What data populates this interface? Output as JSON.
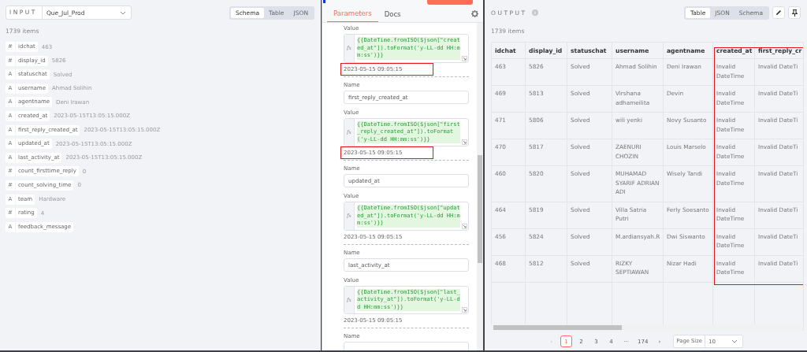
{
  "input_panel": {
    "title": "INPUT",
    "source": "Que_Jul_Prod",
    "views": [
      {
        "label": "Schema",
        "selected": true
      },
      {
        "label": "Table",
        "selected": false
      },
      {
        "label": "JSON",
        "selected": false
      }
    ],
    "count": "1739 items",
    "fields": [
      {
        "glyph": "#",
        "name": "idchat",
        "value": "463"
      },
      {
        "glyph": "#",
        "name": "display_id",
        "value": "5826"
      },
      {
        "glyph": "A",
        "name": "statuschat",
        "value": "Solved"
      },
      {
        "glyph": "A",
        "name": "username",
        "value": "Ahmad Solihin"
      },
      {
        "glyph": "A",
        "name": "agentname",
        "value": "Deni Irawan"
      },
      {
        "glyph": "A",
        "name": "created_at",
        "value": "2023-05-15T13:05:15.000Z"
      },
      {
        "glyph": "A",
        "name": "first_reply_created_at",
        "value": "2023-05-15T13:05:15.000Z"
      },
      {
        "glyph": "A",
        "name": "updated_at",
        "value": "2023-05-15T13:05:15.000Z"
      },
      {
        "glyph": "A",
        "name": "last_activity_at",
        "value": "2023-05-15T13:05:15.000Z"
      },
      {
        "glyph": "#",
        "name": "count_firsttime_reply",
        "value": "0"
      },
      {
        "glyph": "#",
        "name": "count_solving_time",
        "value": "0"
      },
      {
        "glyph": "A",
        "name": "team",
        "value": "Hardware"
      },
      {
        "glyph": "#",
        "name": "rating",
        "value": "4"
      },
      {
        "glyph": "A",
        "name": "feedback_message"
      }
    ]
  },
  "node_panel": {
    "tabs": [
      {
        "label": "Parameters",
        "selected": true
      },
      {
        "label": "Docs",
        "selected": false
      }
    ],
    "entries": [
      {
        "kind": "value",
        "label": "Value",
        "fx": "fx",
        "expression": "{{DateTime.fromISO($json[\"created_at\"]).toFormat('y-LL-dd HH:mm:ss')}}",
        "result": "2023-05-15 09:05:15",
        "highlighted": true
      },
      {
        "kind": "name",
        "label": "Name",
        "value": "first_reply_created_at"
      },
      {
        "kind": "value",
        "label": "Value",
        "fx": "fx",
        "expression": "{{DateTime.fromISO($json[\"first_reply_created_at\"]).toFormat('y-LL-dd HH:mm:ss')}}",
        "result": "2023-05-15 09:05:15",
        "highlighted": true
      },
      {
        "kind": "name",
        "label": "Name",
        "value": "updated_at"
      },
      {
        "kind": "value",
        "label": "Value",
        "fx": "fx",
        "expression": "{{DateTime.fromISO($json[\"updated_at\"]).toFormat('y-LL-dd HH:mm:ss')}}",
        "result": "2023-05-15 09:05:15"
      },
      {
        "kind": "name",
        "label": "Name",
        "value": "last_activity_at"
      },
      {
        "kind": "value",
        "label": "Value",
        "fx": "fx",
        "expression": "{{DateTime.fromISO($json[\"last_activity_at\"]).toFormat('y-LL-dd HH:mm:ss')}}",
        "result": "2023-05-15 09:05:15"
      },
      {
        "kind": "name",
        "label": "Name"
      }
    ]
  },
  "output_panel": {
    "title": "OUTPUT",
    "views": [
      {
        "label": "Table",
        "selected": true
      },
      {
        "label": "JSON",
        "selected": false
      },
      {
        "label": "Schema",
        "selected": false
      }
    ],
    "count": "1739 items",
    "table": {
      "columns": [
        "idchat",
        "display_id",
        "statuschat",
        "username",
        "agentname",
        "created_at",
        "first_reply_cr"
      ],
      "rows": [
        [
          "463",
          "5826",
          "Solved",
          "Ahmad Solihin",
          "Deni Irawan",
          "Invalid DateTime",
          "Invalid DateTi"
        ],
        [
          "469",
          "5813",
          "Solved",
          "Virshana adhameilita",
          "Devin",
          "Invalid DateTime",
          "Invalid DateTi"
        ],
        [
          "471",
          "5806",
          "Solved",
          "wili yenki",
          "Novy Susanto",
          "Invalid DateTime",
          "Invalid DateTi"
        ],
        [
          "470",
          "5817",
          "Solved",
          "ZAENURI CHOZIN",
          "Louis Marselo",
          "Invalid DateTime",
          "Invalid DateTi"
        ],
        [
          "460",
          "5820",
          "Solved",
          "MUHAMAD SYARIF ADRIAN ADI",
          "Wisely Tandi",
          "Invalid DateTime",
          "Invalid DateTi"
        ],
        [
          "464",
          "5819",
          "Solved",
          "Villa Satria Putri",
          "Ferly Soesanto",
          "Invalid DateTime",
          "Invalid DateTi"
        ],
        [
          "456",
          "5824",
          "Solved",
          "M.ardiansyah.R",
          "Dwi Siswanto",
          "Invalid DateTime",
          "Invalid DateTi"
        ],
        [
          "468",
          "5812",
          "Solved",
          "RIZKY SEPTIAWAN",
          "Nizar Hadi",
          "Invalid DateTime",
          "Invalid DateTi"
        ]
      ]
    },
    "pagination": {
      "prev": "‹",
      "pages": [
        {
          "label": "1",
          "selected": true
        },
        {
          "label": "2",
          "selected": false
        },
        {
          "label": "3",
          "selected": false
        },
        {
          "label": "4",
          "selected": false
        }
      ],
      "ellipsis": "···",
      "last": "174",
      "next": "›",
      "page_size_label": "Page Size",
      "page_size": "10"
    }
  }
}
